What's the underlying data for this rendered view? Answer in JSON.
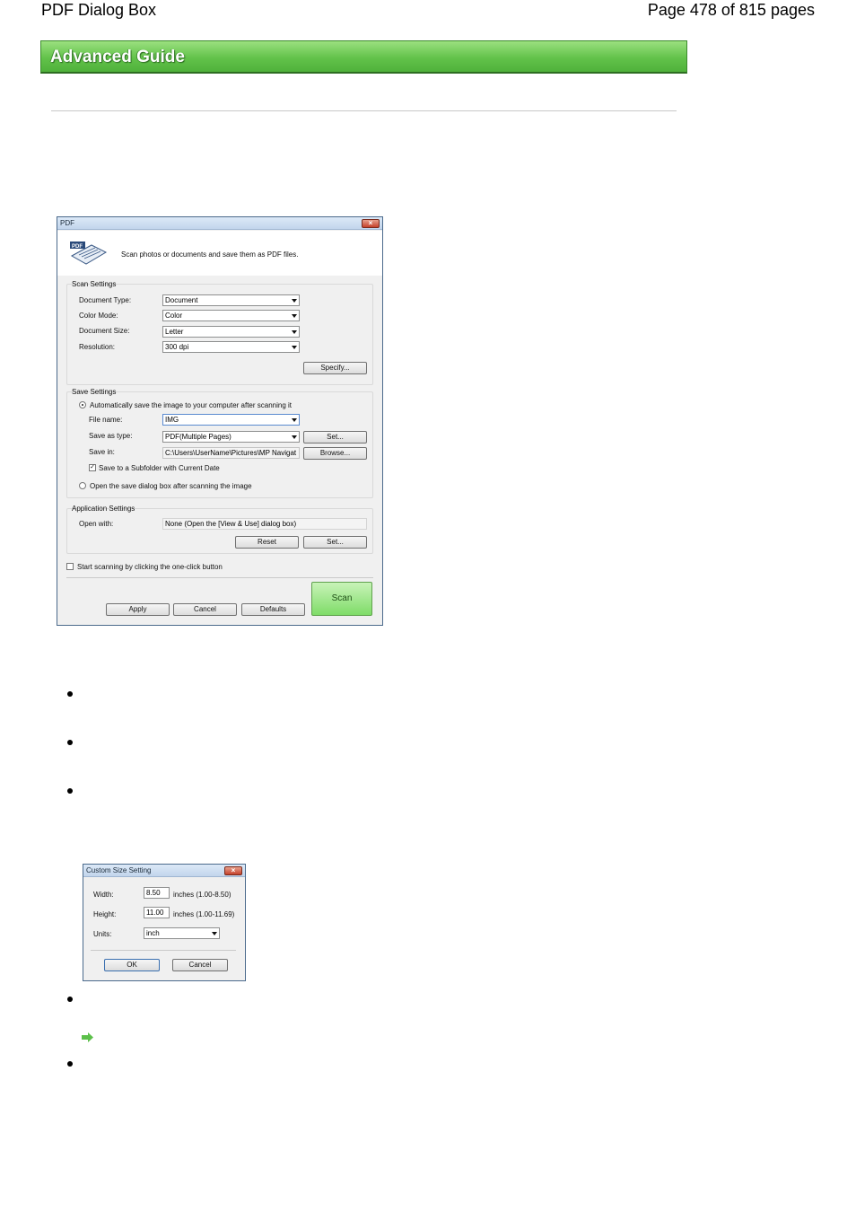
{
  "header": {
    "left": "PDF Dialog Box",
    "right": "Page 478 of 815 pages"
  },
  "banner": {
    "label": "Advanced Guide"
  },
  "pdf_dialog": {
    "title": "PDF",
    "description": "Scan photos or documents and save them as PDF files.",
    "icon_label": "PDF",
    "scan_settings": {
      "title": "Scan Settings",
      "document_type_label": "Document Type:",
      "document_type_value": "Document",
      "color_mode_label": "Color Mode:",
      "color_mode_value": "Color",
      "document_size_label": "Document Size:",
      "document_size_value": "Letter",
      "resolution_label": "Resolution:",
      "resolution_value": "300 dpi",
      "specify_button": "Specify..."
    },
    "save_settings": {
      "title": "Save Settings",
      "auto_save_label": "Automatically save the image to your computer after scanning it",
      "file_name_label": "File name:",
      "file_name_value": "IMG",
      "save_as_type_label": "Save as type:",
      "save_as_type_value": "PDF(Multiple Pages)",
      "set_button": "Set...",
      "save_in_label": "Save in:",
      "save_in_value": "C:\\Users\\UserName\\Pictures\\MP Navigat",
      "browse_button": "Browse...",
      "subfolder_label": "Save to a Subfolder with Current Date",
      "open_dialog_label": "Open the save dialog box after scanning the image"
    },
    "application_settings": {
      "title": "Application Settings",
      "open_with_label": "Open with:",
      "open_with_value": "None (Open the [View & Use] dialog box)",
      "reset_button": "Reset",
      "set_button": "Set..."
    },
    "one_click_label": "Start scanning by clicking the one-click button",
    "apply_button": "Apply",
    "cancel_button": "Cancel",
    "defaults_button": "Defaults",
    "scan_button": "Scan"
  },
  "custom_size_dialog": {
    "title": "Custom Size Setting",
    "width_label": "Width:",
    "width_value": "8.50",
    "width_range": "inches (1.00-8.50)",
    "height_label": "Height:",
    "height_value": "11.00",
    "height_range": "inches (1.00-11.69)",
    "units_label": "Units:",
    "units_value": "inch",
    "ok_button": "OK",
    "cancel_button": "Cancel"
  },
  "colors": {
    "banner_green": "#62c24a",
    "scan_green": "#7fdc68",
    "link_arrow": "#5cc04a"
  }
}
